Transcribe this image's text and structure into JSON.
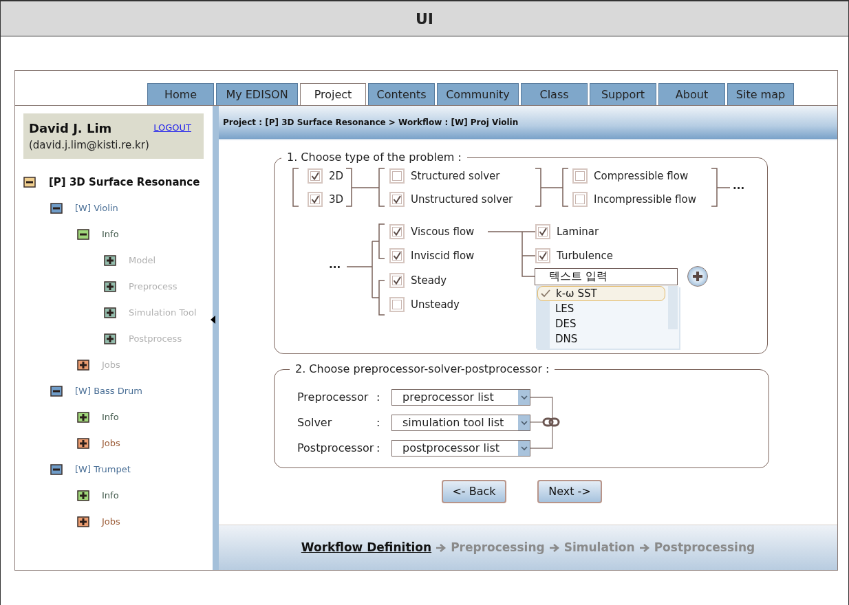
{
  "window": {
    "title": "UI"
  },
  "tabs": [
    {
      "label": "Home",
      "selected": false
    },
    {
      "label": "My EDISON",
      "selected": false
    },
    {
      "label": "Project",
      "selected": true
    },
    {
      "label": "Contents",
      "selected": false
    },
    {
      "label": "Community",
      "selected": false
    },
    {
      "label": "Class",
      "selected": false
    },
    {
      "label": "Support",
      "selected": false
    },
    {
      "label": "About",
      "selected": false
    },
    {
      "label": "Site map",
      "selected": false
    }
  ],
  "user": {
    "name": "David J. Lim",
    "email": "(david.j.lim@kisti.re.kr)",
    "logout": "LOGOUT"
  },
  "tree": [
    {
      "label": "[P] 3D Surface Resonance",
      "kind": "project",
      "expanded": true,
      "disabled": false,
      "children": [
        {
          "label": "[W] Violin",
          "kind": "workflow",
          "expanded": true,
          "disabled": false,
          "children": [
            {
              "label": "Info",
              "kind": "info",
              "expanded": true,
              "disabled": false,
              "children": [
                {
                  "label": "Model",
                  "kind": "step",
                  "expanded": false,
                  "disabled": true
                },
                {
                  "label": "Preprocess",
                  "kind": "step",
                  "expanded": false,
                  "disabled": true
                },
                {
                  "label": "Simulation Tool",
                  "kind": "step",
                  "expanded": false,
                  "disabled": true
                },
                {
                  "label": "Postprocess",
                  "kind": "step",
                  "expanded": false,
                  "disabled": true
                }
              ]
            },
            {
              "label": "Jobs",
              "kind": "jobs",
              "expanded": false,
              "disabled": true
            }
          ]
        },
        {
          "label": "[W] Bass Drum",
          "kind": "workflow",
          "expanded": true,
          "disabled": false,
          "children": [
            {
              "label": "Info",
              "kind": "info",
              "expanded": false,
              "disabled": false
            },
            {
              "label": "Jobs",
              "kind": "jobs",
              "expanded": false,
              "disabled": false
            }
          ]
        },
        {
          "label": "[W] Trumpet",
          "kind": "workflow",
          "expanded": true,
          "disabled": false,
          "children": [
            {
              "label": "Info",
              "kind": "info",
              "expanded": false,
              "disabled": false
            },
            {
              "label": "Jobs",
              "kind": "jobs",
              "expanded": false,
              "disabled": false
            }
          ]
        }
      ]
    }
  ],
  "breadcrumb": "Project : [P] 3D Surface Resonance > Workflow : [W] Proj Violin",
  "problem_type": {
    "title": "1. Choose type of the problem :",
    "dimension": [
      {
        "label": "2D",
        "checked": true
      },
      {
        "label": "3D",
        "checked": true
      }
    ],
    "solver": [
      {
        "label": "Structured solver",
        "checked": false
      },
      {
        "label": "Unstructured solver",
        "checked": true
      }
    ],
    "compressibility": [
      {
        "label": "Compressible flow",
        "checked": false
      },
      {
        "label": "Incompressible flow",
        "checked": false
      }
    ],
    "more_right": "...",
    "more_left": "...",
    "viscosity": [
      {
        "label": "Viscous flow",
        "checked": true
      },
      {
        "label": "Inviscid flow",
        "checked": true
      }
    ],
    "time": [
      {
        "label": "Steady",
        "checked": true
      },
      {
        "label": "Unsteady",
        "checked": false
      }
    ],
    "turbulence": [
      {
        "label": "Laminar",
        "checked": true
      },
      {
        "label": "Turbulence",
        "checked": true
      }
    ],
    "model_input": {
      "value": "텍스트 입력"
    },
    "model_list": [
      {
        "label": "k-ω SST",
        "selected": true
      },
      {
        "label": "LES",
        "selected": false
      },
      {
        "label": "DES",
        "selected": false
      },
      {
        "label": "DNS",
        "selected": false
      }
    ]
  },
  "toolchain": {
    "title": "2. Choose preprocessor-solver-postprocessor :",
    "rows": [
      {
        "label": "Preprocessor",
        "separator": ":",
        "value": "preprocessor list"
      },
      {
        "label": "Solver",
        "separator": ":",
        "value": "simulation tool list"
      },
      {
        "label": "Postprocessor",
        "separator": ":",
        "value": "postprocessor list"
      }
    ]
  },
  "buttons": [
    {
      "label": "<- Back"
    },
    {
      "label": "Next ->"
    }
  ],
  "steps": [
    {
      "label": "Workflow Definition",
      "selected": true
    },
    {
      "label": "Preprocessing",
      "selected": false
    },
    {
      "label": "Simulation",
      "selected": false
    },
    {
      "label": "Postprocessing",
      "selected": false
    }
  ]
}
